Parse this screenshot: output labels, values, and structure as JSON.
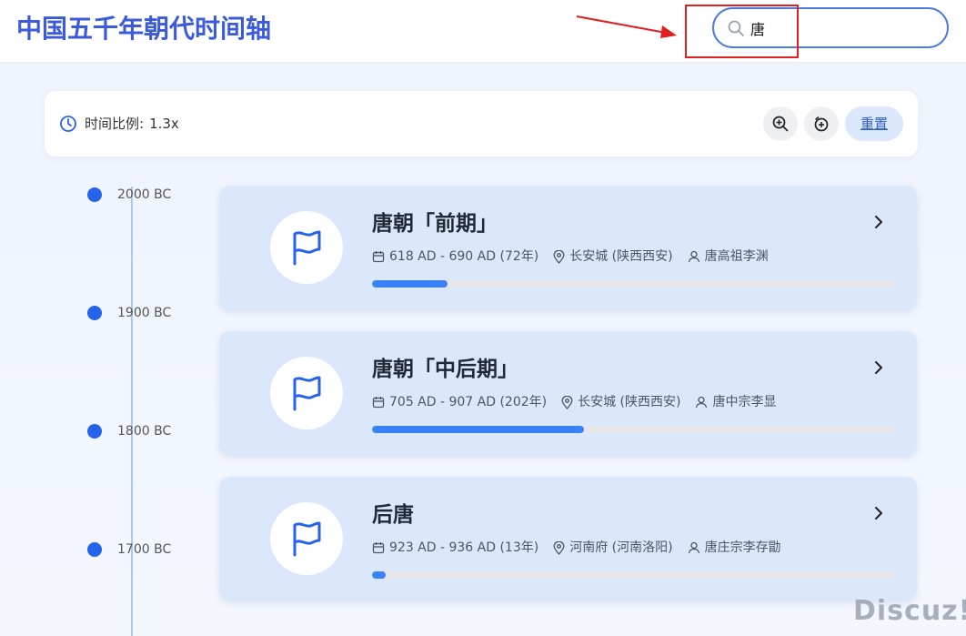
{
  "header": {
    "title": "中国五千年朝代时间轴",
    "search_value": "唐",
    "accent_color": "#3b5bdb"
  },
  "toolbar": {
    "scale_label": "时间比例:",
    "scale_value": "1.3x",
    "reset_label": "重置",
    "icons": [
      "clock-icon",
      "zoom-in-icon",
      "zoom-out-icon"
    ]
  },
  "timeline": {
    "ticks": [
      "2000 BC",
      "1900 BC",
      "1800 BC",
      "1700 BC"
    ]
  },
  "cards": [
    {
      "title": "唐朝「前期」",
      "period": "618 AD - 690 AD (72年)",
      "capital": "长安城 (陕西西安)",
      "founder": "唐高祖李渊",
      "progress_fraction": 0.144
    },
    {
      "title": "唐朝「中后期」",
      "period": "705 AD - 907 AD (202年)",
      "capital": "长安城 (陕西西安)",
      "founder": "唐中宗李显",
      "progress_fraction": 0.405
    },
    {
      "title": "后唐",
      "period": "923 AD - 936 AD (13年)",
      "capital": "河南府 (河南洛阳)",
      "founder": "唐庄宗李存勖",
      "progress_fraction": 0.026
    }
  ],
  "watermark": "Discuz!"
}
